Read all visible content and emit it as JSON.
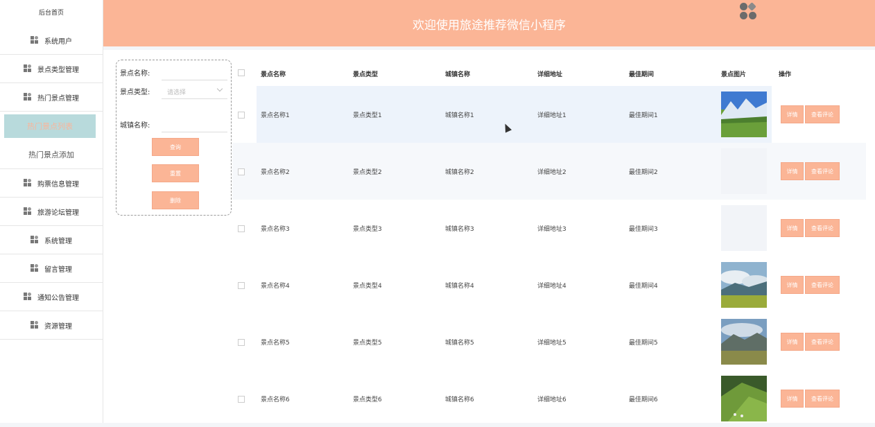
{
  "sidebar": {
    "home": "后台首页",
    "items": [
      {
        "label": "系统用户",
        "icon": "grid-icon"
      },
      {
        "label": "景点类型管理",
        "icon": "grid-icon"
      },
      {
        "label": "热门景点管理",
        "icon": "grid-icon"
      },
      {
        "label": "热门景点列表",
        "sub": true,
        "active": true
      },
      {
        "label": "热门景点添加",
        "sub": true
      },
      {
        "label": "购票信息管理",
        "icon": "grid-icon"
      },
      {
        "label": "旅游论坛管理",
        "icon": "grid-icon"
      },
      {
        "label": "系统管理",
        "icon": "grid-icon"
      },
      {
        "label": "留言管理",
        "icon": "grid-icon"
      },
      {
        "label": "通知公告管理",
        "icon": "grid-icon"
      },
      {
        "label": "资源管理",
        "icon": "grid-icon"
      }
    ]
  },
  "header": {
    "title": "欢迎使用旅途推荐微信小程序",
    "accent": "#fbb596"
  },
  "search": {
    "name_label": "景点名称:",
    "type_label": "景点类型:",
    "type_placeholder": "请选择",
    "city_label": "城镇名称:",
    "query_btn": "查询",
    "reset_btn": "重置",
    "delete_btn": "删除"
  },
  "table": {
    "columns": [
      "景点名称",
      "景点类型",
      "城镇名称",
      "详细地址",
      "最佳期间",
      "景点图片",
      "操作"
    ],
    "rows": [
      {
        "name": "景点名称1",
        "type": "景点类型1",
        "city": "城镇名称1",
        "addr": "详细地址1",
        "best": "最佳期间1",
        "img": "mountain-meadow"
      },
      {
        "name": "景点名称2",
        "type": "景点类型2",
        "city": "城镇名称2",
        "addr": "详细地址2",
        "best": "最佳期间2",
        "img": "empty"
      },
      {
        "name": "景点名称3",
        "type": "景点类型3",
        "city": "城镇名称3",
        "addr": "详细地址3",
        "best": "最佳期间3",
        "img": "empty"
      },
      {
        "name": "景点名称4",
        "type": "景点类型4",
        "city": "城镇名称4",
        "addr": "详细地址4",
        "best": "最佳期间4",
        "img": "cloudy-grassland"
      },
      {
        "name": "景点名称5",
        "type": "景点类型5",
        "city": "城镇名称5",
        "addr": "详细地址5",
        "best": "最佳期间5",
        "img": "valley-pasture"
      },
      {
        "name": "景点名称6",
        "type": "景点类型6",
        "city": "城镇名称6",
        "addr": "详细地址6",
        "best": "最佳期间6",
        "img": "green-hills"
      }
    ],
    "detail_btn": "详情",
    "comment_btn": "查看评论"
  }
}
